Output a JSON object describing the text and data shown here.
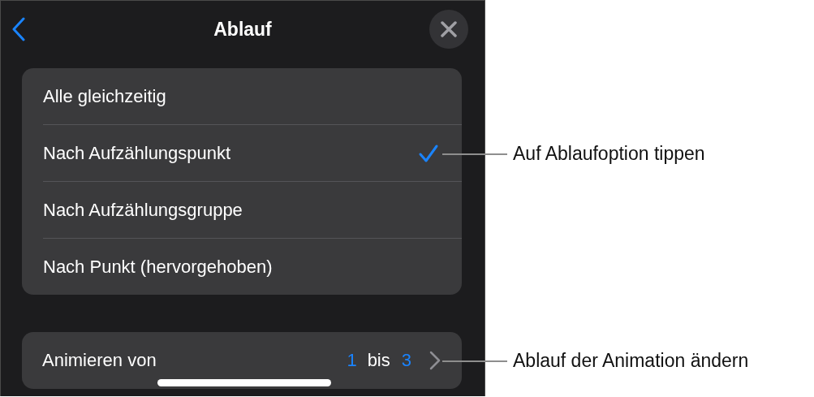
{
  "header": {
    "title": "Ablauf"
  },
  "options": [
    {
      "label": "Alle gleichzeitig",
      "selected": false
    },
    {
      "label": "Nach Aufzählungspunkt",
      "selected": true
    },
    {
      "label": "Nach Aufzählungsgruppe",
      "selected": false
    },
    {
      "label": "Nach Punkt (hervorgehoben)",
      "selected": false
    }
  ],
  "animate": {
    "label": "Animieren von",
    "from": "1",
    "word": "bis",
    "to": "3"
  },
  "callouts": [
    "Auf Ablaufoption tippen",
    "Ablauf der Animation ändern"
  ]
}
